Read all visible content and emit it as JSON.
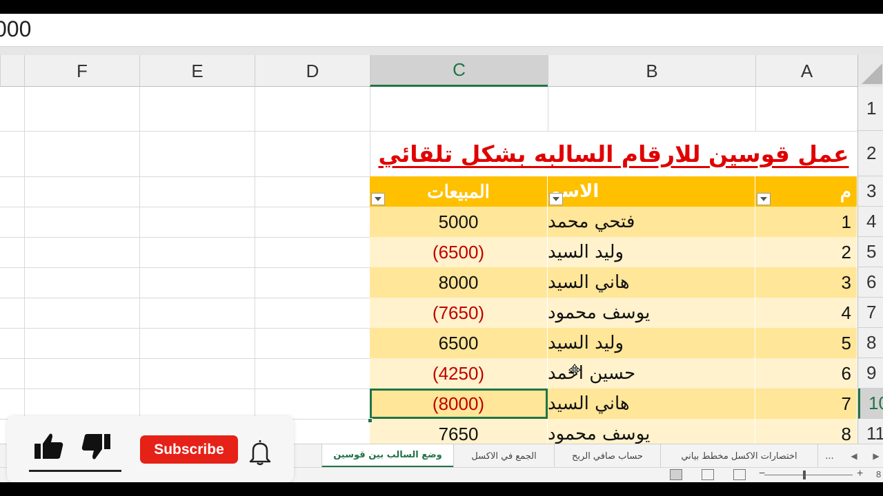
{
  "formula_bar": {
    "value": "000"
  },
  "columns": [
    {
      "letter": "F",
      "active": false
    },
    {
      "letter": "E",
      "active": false
    },
    {
      "letter": "D",
      "active": false
    },
    {
      "letter": "C",
      "active": true
    },
    {
      "letter": "B",
      "active": false
    },
    {
      "letter": "A",
      "active": false
    }
  ],
  "row_numbers": [
    "1",
    "2",
    "3",
    "4",
    "5",
    "6",
    "7",
    "8",
    "9",
    "10",
    "11"
  ],
  "active_row": "10",
  "title": "عمل قوسين للارقام السالبه بشكل تلقائي",
  "table": {
    "headers": {
      "c": "المبيعات",
      "b": "الاسم",
      "a": "م"
    },
    "rows": [
      {
        "c": "5000",
        "b": "فتحي محمد",
        "a": "1",
        "negative": false
      },
      {
        "c": "(6500)",
        "b": "وليد السيد",
        "a": "2",
        "negative": true
      },
      {
        "c": "8000",
        "b": "هاني السيد",
        "a": "3",
        "negative": false
      },
      {
        "c": "(7650)",
        "b": "يوسف محمود",
        "a": "4",
        "negative": true
      },
      {
        "c": "6500",
        "b": "وليد السيد",
        "a": "5",
        "negative": false
      },
      {
        "c": "(4250)",
        "b": "حسين احمد",
        "a": "6",
        "negative": true
      },
      {
        "c": "(8000)",
        "b": "هاني السيد",
        "a": "7",
        "negative": true
      },
      {
        "c": "7650",
        "b": "يوسف محمود",
        "a": "8",
        "negative": false
      }
    ],
    "selected_row": 6
  },
  "sheet_tabs": [
    {
      "label": "وضع السالب بين قوسين",
      "active": true
    },
    {
      "label": "الجمع في الاكسل",
      "active": false
    },
    {
      "label": "حساب صافي الربح",
      "active": false
    },
    {
      "label": "اختصارات الاكسل مخطط بياني",
      "active": false
    },
    {
      "label": "...",
      "active": false
    }
  ],
  "status": {
    "zoom_pct": "8"
  },
  "overlay": {
    "subscribe_label": "Subscribe"
  },
  "colors": {
    "excel_green": "#217346",
    "header_orange": "#ffc000",
    "band_dark": "#ffe699",
    "band_light": "#fff2cc",
    "negative_red": "#c00000",
    "title_red": "#e00000",
    "subscribe_red": "#e62117"
  },
  "icons": [
    "like-icon",
    "dislike-icon",
    "bell-icon",
    "move-cursor-icon",
    "dropdown-arrow-icon",
    "normal-view-icon",
    "page-layout-icon",
    "page-break-icon"
  ]
}
